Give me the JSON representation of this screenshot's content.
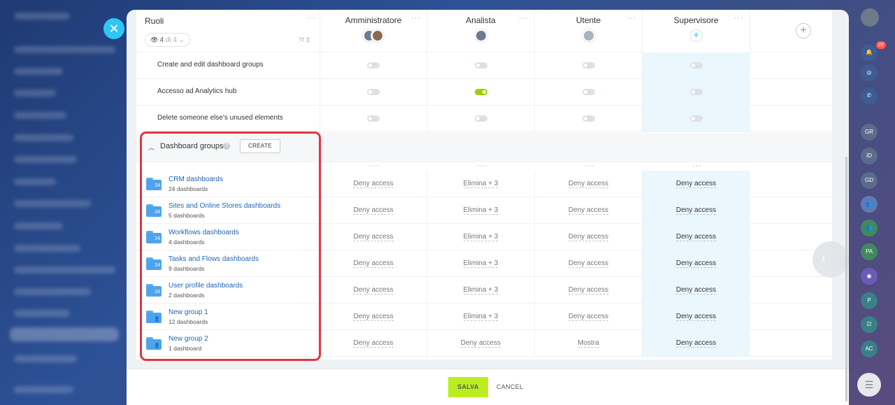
{
  "header": {
    "roles_title": "Ruoli",
    "counter_current": "4",
    "counter_of": "di 4",
    "columns": [
      "Amministratore",
      "Analista",
      "Utente",
      "Supervisore"
    ]
  },
  "permissions": [
    {
      "label": "Create and edit dashboard groups",
      "values": [
        "off",
        "off",
        "off",
        "off"
      ]
    },
    {
      "label": "Accesso ad Analytics hub",
      "values": [
        "off",
        "on",
        "off",
        "off"
      ]
    },
    {
      "label": "Delete someone else's unused elements",
      "values": [
        "off",
        "off",
        "off",
        "off"
      ]
    }
  ],
  "dashboard_groups": {
    "title": "Dashboard groups",
    "create_label": "CREATE",
    "items": [
      {
        "name": "CRM dashboards",
        "count": "24 dashboards",
        "access": [
          "Deny access",
          "Elimina + 3",
          "Deny access",
          "Deny access"
        ]
      },
      {
        "name": "Sites and Online Stores dashboards",
        "count": "5 dashboards",
        "access": [
          "Deny access",
          "Elimina + 3",
          "Deny access",
          "Deny access"
        ]
      },
      {
        "name": "Workflows dashboards",
        "count": "4 dashboards",
        "access": [
          "Deny access",
          "Elimina + 3",
          "Deny access",
          "Deny access"
        ]
      },
      {
        "name": "Tasks and Flows dashboards",
        "count": "9 dashboards",
        "access": [
          "Deny access",
          "Elimina + 3",
          "Deny access",
          "Deny access"
        ]
      },
      {
        "name": "User profile dashboards",
        "count": "2 dashboards",
        "access": [
          "Deny access",
          "Elimina + 3",
          "Deny access",
          "Deny access"
        ]
      },
      {
        "name": "New group 1",
        "count": "12 dashboards",
        "access": [
          "Deny access",
          "Elimina + 3",
          "Deny access",
          "Deny access"
        ]
      },
      {
        "name": "New group 2",
        "count": "1 dashboard",
        "access": [
          "Deny access",
          "Deny access",
          "Mostra",
          "Deny access"
        ]
      }
    ]
  },
  "footer": {
    "save_label": "SALVA",
    "cancel_label": "CANCEL"
  },
  "right_bar": {
    "notifications_count": "22",
    "initials": [
      "GR",
      "ID",
      "GD",
      "PA",
      "P",
      "AC"
    ]
  },
  "colors": {
    "accent": "#2fc6f6",
    "save": "#bbed21",
    "toggle_on": "#9dcf00",
    "highlight": "#e2353f",
    "link": "#2067b0"
  }
}
